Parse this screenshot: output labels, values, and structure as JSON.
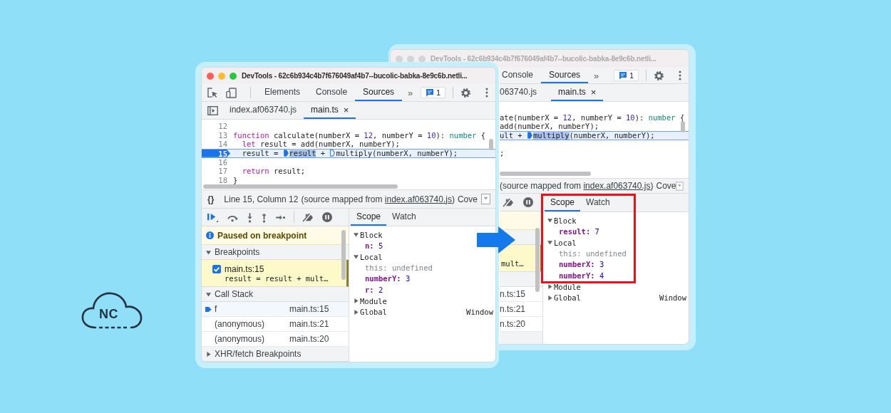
{
  "logo": {
    "text": "NC"
  },
  "back_window": {
    "title": "DevTools - 62c6b934c4b7f676049af4b7--bucolic-babka-8e9c6b.netli...",
    "focused": false,
    "panel_tabs": [
      {
        "label": "Console",
        "selected": false
      },
      {
        "label": "Sources",
        "selected": true
      }
    ],
    "more_tabs": "»",
    "issues": "1",
    "file_tabs": [
      {
        "label": "063740.js",
        "selected": false
      },
      {
        "label": "main.ts",
        "selected": true,
        "close": "×"
      }
    ],
    "code": [
      {
        "current": false
      },
      {
        "current": false,
        "tokens": [
          {
            "t": "ate(numberX = ",
            "kind": "plain"
          },
          {
            "t": "12",
            "kind": "number"
          },
          {
            "t": ", numberY = ",
            "kind": "plain"
          },
          {
            "t": "10",
            "kind": "number"
          },
          {
            "t": "): ",
            "kind": "plain"
          },
          {
            "t": "number",
            "kind": "type"
          },
          {
            "t": " {",
            "kind": "plain"
          }
        ]
      },
      {
        "current": false,
        "tokens": [
          {
            "t": "add(numberX, numberY);",
            "kind": "plain"
          }
        ]
      },
      {
        "current": true,
        "tokens": [
          {
            "t": "ult + ",
            "kind": "plain"
          },
          {
            "kind": "marker_filled"
          },
          {
            "t": "multiply",
            "kind": "selection"
          },
          {
            "t": "(numberX, numberY);",
            "kind": "plain"
          }
        ]
      },
      {
        "current": false
      },
      {
        "current": false,
        "tokens": [
          {
            "t": ";",
            "kind": "plain"
          }
        ]
      }
    ],
    "status": {
      "mapped_prefix": "(source mapped from",
      "mapped_link": "index.af063740.js",
      "mapped_suffix": ")",
      "coverage": "Cove"
    },
    "breakpoint_snippet": "mult…",
    "call_stack_locations": [
      "n.ts:15",
      "n.ts:21",
      "n.ts:20"
    ],
    "scope": {
      "highlighted": true,
      "tabs": [
        {
          "label": "Scope",
          "selected": true
        },
        {
          "label": "Watch",
          "selected": false
        }
      ],
      "groups": [
        {
          "name": "Block",
          "expanded": true,
          "vars": [
            {
              "name": "result:",
              "value": "7",
              "kind": "number"
            }
          ]
        },
        {
          "name": "Local",
          "expanded": true,
          "vars": [
            {
              "name": "this:",
              "value": "undefined",
              "kind": "undefined"
            },
            {
              "name": "numberX:",
              "value": "3",
              "kind": "number"
            },
            {
              "name": "numberY:",
              "value": "4",
              "kind": "number"
            }
          ]
        },
        {
          "name": "Module",
          "expanded": false
        },
        {
          "name": "Global",
          "expanded": false,
          "value": "Window"
        }
      ]
    }
  },
  "front_window": {
    "title": "DevTools - 62c6b934c4b7f676049af4b7--bucolic-babka-8e9c6b.netli...",
    "focused": true,
    "panel_tabs": [
      {
        "label": "Elements",
        "selected": false
      },
      {
        "label": "Console",
        "selected": false
      },
      {
        "label": "Sources",
        "selected": true
      }
    ],
    "more_tabs": "»",
    "issues": "1",
    "file_tabs": [
      {
        "label": "index.af063740.js",
        "selected": false
      },
      {
        "label": "main.ts",
        "selected": true,
        "close": "×"
      }
    ],
    "code": [
      {
        "number": "12",
        "current": false
      },
      {
        "number": "13",
        "current": false,
        "tokens": [
          {
            "t": "function",
            "kind": "keyword"
          },
          {
            "t": " calculate(numberX = ",
            "kind": "plain"
          },
          {
            "t": "12",
            "kind": "number"
          },
          {
            "t": ", numberY = ",
            "kind": "plain"
          },
          {
            "t": "10",
            "kind": "number"
          },
          {
            "t": "): ",
            "kind": "plain"
          },
          {
            "t": "number",
            "kind": "type"
          },
          {
            "t": " {",
            "kind": "plain"
          }
        ]
      },
      {
        "number": "14",
        "current": false,
        "tokens": [
          {
            "t": "  let",
            "kind": "keyword"
          },
          {
            "t": " result = add(numberX, numberY);",
            "kind": "plain"
          }
        ]
      },
      {
        "number": "15",
        "current": true,
        "tokens": [
          {
            "t": "  result = ",
            "kind": "plain"
          },
          {
            "kind": "marker_filled"
          },
          {
            "t": "result",
            "kind": "selection"
          },
          {
            "t": " + ",
            "kind": "plain"
          },
          {
            "kind": "marker_hollow"
          },
          {
            "t": "multiply(numberX, numberY);",
            "kind": "plain"
          }
        ]
      },
      {
        "number": "16",
        "current": false
      },
      {
        "number": "17",
        "current": false,
        "tokens": [
          {
            "t": "  return",
            "kind": "keyword"
          },
          {
            "t": " result;",
            "kind": "plain"
          }
        ]
      },
      {
        "number": "18",
        "current": false,
        "tokens": [
          {
            "t": "}",
            "kind": "plain"
          }
        ]
      }
    ],
    "status": {
      "format_button": "{}",
      "position": "Line 15, Column 12",
      "mapped_prefix": "(source mapped from",
      "mapped_link": "index.af063740.js",
      "mapped_suffix": ")",
      "coverage": "Cove"
    },
    "banner": "Paused on breakpoint",
    "breakpoints": {
      "title": "Breakpoints",
      "expanded": true,
      "items": [
        {
          "file": "main.ts:15",
          "code": "result = result + mult…",
          "checked": true
        }
      ]
    },
    "call_stack": {
      "title": "Call Stack",
      "expanded": true,
      "frames": [
        {
          "name": "f",
          "location": "main.ts:15",
          "current": true
        },
        {
          "name": "(anonymous)",
          "location": "main.ts:21",
          "current": false
        },
        {
          "name": "(anonymous)",
          "location": "main.ts:20",
          "current": false
        }
      ]
    },
    "xhr_breakpoints": {
      "title": "XHR/fetch Breakpoints",
      "expanded": false
    },
    "scope": {
      "highlighted": false,
      "tabs": [
        {
          "label": "Scope",
          "selected": true
        },
        {
          "label": "Watch",
          "selected": false
        }
      ],
      "groups": [
        {
          "name": "Block",
          "expanded": true,
          "vars": [
            {
              "name": "n:",
              "value": "5",
              "kind": "number"
            }
          ]
        },
        {
          "name": "Local",
          "expanded": true,
          "vars": [
            {
              "name": "this:",
              "value": "undefined",
              "kind": "undefined"
            },
            {
              "name": "numberY:",
              "value": "3",
              "kind": "number"
            },
            {
              "name": "r:",
              "value": "2",
              "kind": "number"
            }
          ]
        },
        {
          "name": "Module",
          "expanded": false
        },
        {
          "name": "Global",
          "expanded": false,
          "value": "Window"
        }
      ]
    }
  }
}
